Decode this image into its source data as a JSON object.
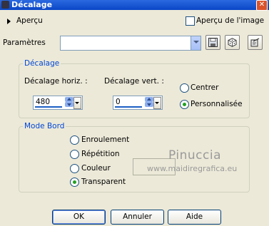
{
  "window": {
    "title": "Décalage",
    "close_symbol": "✕"
  },
  "preview": {
    "label": "Aperçu",
    "image_preview_label": "Aperçu de l'image",
    "image_preview_checked": false
  },
  "parameters": {
    "label": "Paramètres",
    "value": ""
  },
  "offset_group": {
    "legend": "Décalage",
    "horiz_label": "Décalage horiz. :",
    "horiz_value": "480",
    "vert_label": "Décalage vert. :",
    "vert_value": "0",
    "center_label": "Centrer",
    "custom_label": "Personnalisée",
    "selected": "Personnalisée"
  },
  "edge_group": {
    "legend": "Mode Bord",
    "options": [
      "Enroulement",
      "Répétition",
      "Couleur",
      "Transparent"
    ],
    "selected": "Transparent"
  },
  "watermark": {
    "line1": "Pinuccia",
    "line2": "www.maidiregrafica.eu"
  },
  "buttons": {
    "ok": "OK",
    "cancel": "Annuler",
    "help": "Aide"
  }
}
